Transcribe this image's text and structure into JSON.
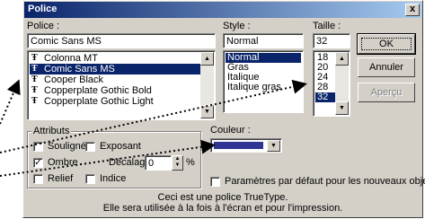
{
  "dialog": {
    "title": "Police",
    "close_glyph": "x",
    "font_label": "Police :",
    "font_value": "Comic Sans MS",
    "font_list": [
      {
        "name": "Colonna MT",
        "selected": false
      },
      {
        "name": "Comic Sans MS",
        "selected": true
      },
      {
        "name": "Cooper Black",
        "selected": false
      },
      {
        "name": "Copperplate Gothic Bold",
        "selected": false
      },
      {
        "name": "Copperplate Gothic Light",
        "selected": false
      }
    ],
    "font_icon_glyph": "Ŧ",
    "style_label": "Style :",
    "style_value": "Normal",
    "style_list": [
      {
        "name": "Normal",
        "selected": true
      },
      {
        "name": "Gras",
        "selected": false
      },
      {
        "name": "Italique",
        "selected": false
      },
      {
        "name": "Italique gras",
        "selected": false
      }
    ],
    "size_label": "Taille :",
    "size_value": "32",
    "size_list": [
      {
        "name": "18",
        "selected": false
      },
      {
        "name": "20",
        "selected": false
      },
      {
        "name": "24",
        "selected": false
      },
      {
        "name": "28",
        "selected": false
      },
      {
        "name": "32",
        "selected": true
      }
    ],
    "ok_label": "OK",
    "cancel_label": "Annuler",
    "preview_label": "Aperçu",
    "attributes_label": "Attributs",
    "underline_label": "Souligné",
    "superscript_label": "Exposant",
    "shadow_label": "Ombre",
    "offset_label": "Décalage :",
    "offset_value": "0",
    "offset_unit": "%",
    "emboss_label": "Relief",
    "subscript_label": "Indice",
    "underline_checked": false,
    "superscript_checked": false,
    "shadow_checked": true,
    "emboss_checked": false,
    "subscript_checked": false,
    "color_label": "Couleur :",
    "color_value": "#2e3592",
    "default_label": "Paramètres par défaut pour les nouveaux objets",
    "default_checked": false,
    "info_line1": "Ceci est une police TrueType.",
    "info_line2": "Elle sera utilisée à la fois à l'écran et pour l'impression."
  },
  "scroll_glyphs": {
    "up": "▲",
    "down": "▼"
  },
  "check_glyph": "✓"
}
